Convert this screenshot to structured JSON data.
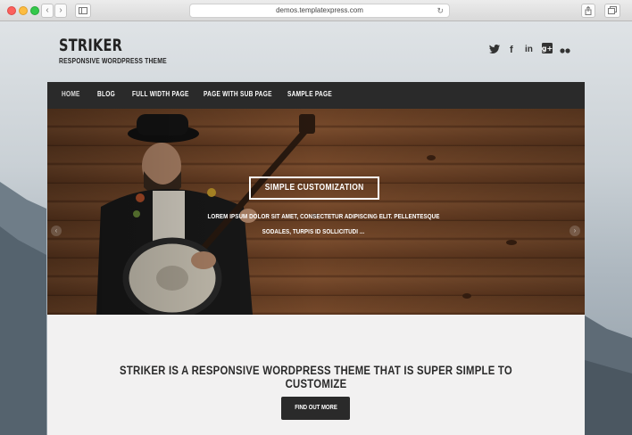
{
  "browser": {
    "url": "demos.templatexpress.com",
    "back_icon": "‹",
    "forward_icon": "›",
    "reload_icon": "↻"
  },
  "site": {
    "title": "STRIKER",
    "tagline": "RESPONSIVE WORDPRESS THEME"
  },
  "social": {
    "twitter": "🐦",
    "facebook": "f",
    "linkedin": "in",
    "googleplus": "g+",
    "flickr": "●●"
  },
  "nav": {
    "items": [
      {
        "label": "HOME"
      },
      {
        "label": "BLOG"
      },
      {
        "label": "FULL WIDTH PAGE"
      },
      {
        "label": "PAGE WITH SUB PAGE"
      },
      {
        "label": "SAMPLE PAGE"
      }
    ]
  },
  "hero": {
    "button_label": "SIMPLE CUSTOMIZATION",
    "text_line1": "LOREM IPSUM DOLOR SIT AMET, CONSECTETUR ADIPISCING ELIT. PELLENTESQUE",
    "text_line2": "SODALES, TURPIS ID SOLLICITUDI ...",
    "prev_arrow": "‹",
    "next_arrow": "›"
  },
  "cta": {
    "heading": "STRIKER IS A RESPONSIVE WORDPRESS THEME THAT IS SUPER SIMPLE TO CUSTOMIZE",
    "button_label": "FIND OUT MORE"
  },
  "colors": {
    "nav_bg": "#2a2a2a",
    "cta_bg": "#f2f1f1",
    "wood": "#6e4326"
  }
}
